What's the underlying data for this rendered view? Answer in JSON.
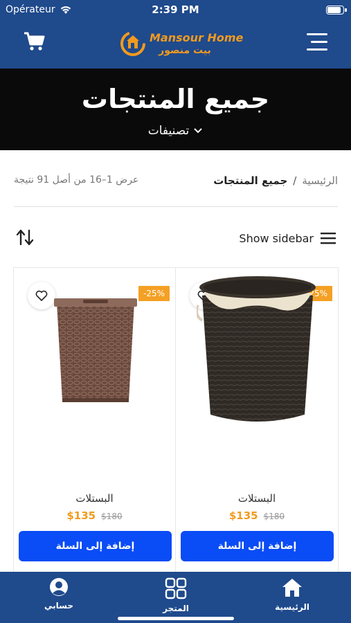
{
  "status_bar": {
    "carrier": "Opérateur",
    "time": "2:39 PM",
    "battery_level": 0.95
  },
  "header": {
    "logo_en": "Mansour Home",
    "logo_ar": "بيت منصور",
    "cart_icon": "cart-icon",
    "menu_icon": "menu-icon"
  },
  "hero": {
    "title": "جميع المنتجات",
    "categories_label": "تصنيفات"
  },
  "breadcrumb": {
    "home": "الرئيسية",
    "separator": "/",
    "current": "جميع المنتجات",
    "results": "عرض 1–16 من أصل 91 نتيجة"
  },
  "toolbar": {
    "show_sidebar": "Show sidebar"
  },
  "products": [
    {
      "name": "البستلات",
      "old_price": "$180",
      "price": "$135",
      "discount": "-25%",
      "add_to_cart": "إضافة إلى السلة"
    },
    {
      "name": "البستلات",
      "old_price": "$180",
      "price": "$135",
      "discount": "-25%",
      "add_to_cart": "إضافة إلى السلة"
    }
  ],
  "bottom_nav": {
    "account": "حسابي",
    "store": "المتجر",
    "home": "الرئيسية"
  },
  "colors": {
    "brand_blue": "#1f4a8c",
    "accent_orange": "#f29a1f",
    "button_blue": "#0a4cf5"
  }
}
